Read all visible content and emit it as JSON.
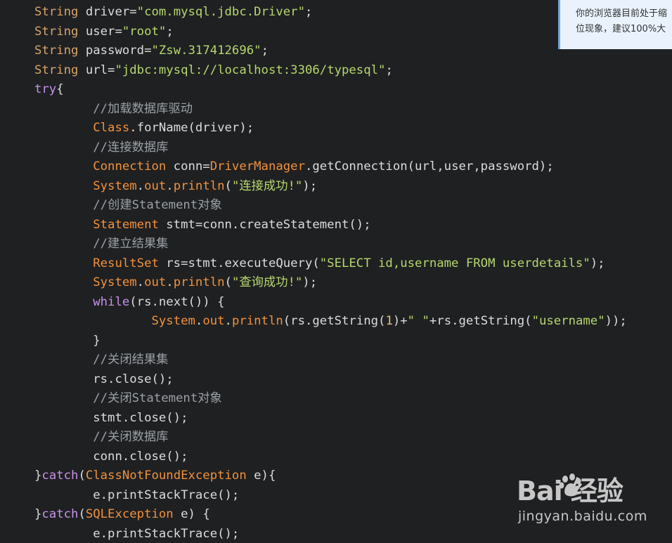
{
  "editor": {
    "lines": [
      [
        {
          "t": "String",
          "c": "kw-type"
        },
        {
          "t": " driver=",
          "c": "fn"
        },
        {
          "t": "\"com.mysql.jdbc.Driver\"",
          "c": "str"
        },
        {
          "t": ";",
          "c": "fn"
        }
      ],
      [
        {
          "t": "String",
          "c": "kw-type"
        },
        {
          "t": " user=",
          "c": "fn"
        },
        {
          "t": "\"root\"",
          "c": "str"
        },
        {
          "t": ";",
          "c": "fn"
        }
      ],
      [
        {
          "t": "String",
          "c": "kw-type"
        },
        {
          "t": " password=",
          "c": "fn"
        },
        {
          "t": "\"Zsw.317412696\"",
          "c": "str"
        },
        {
          "t": ";",
          "c": "fn"
        }
      ],
      [
        {
          "t": "String",
          "c": "kw-type"
        },
        {
          "t": " url=",
          "c": "fn"
        },
        {
          "t": "\"jdbc:mysql://localhost:3306/typesql\"",
          "c": "str"
        },
        {
          "t": ";",
          "c": "fn"
        }
      ],
      [
        {
          "t": "try",
          "c": "kw"
        },
        {
          "t": "{",
          "c": "fn"
        }
      ],
      [
        {
          "t": "        //加载数据库驱动",
          "c": "cmt"
        }
      ],
      [
        {
          "t": "        ",
          "c": "fn"
        },
        {
          "t": "Class",
          "c": "cls"
        },
        {
          "t": ".forName(driver);",
          "c": "fn"
        }
      ],
      [
        {
          "t": "        //连接数据库",
          "c": "cmt"
        }
      ],
      [
        {
          "t": "        ",
          "c": "fn"
        },
        {
          "t": "Connection",
          "c": "cls"
        },
        {
          "t": " conn=",
          "c": "fn"
        },
        {
          "t": "DriverManager",
          "c": "cls"
        },
        {
          "t": ".getConnection(url,user,password);",
          "c": "fn"
        }
      ],
      [
        {
          "t": "        ",
          "c": "fn"
        },
        {
          "t": "System",
          "c": "cls"
        },
        {
          "t": ".",
          "c": "fn"
        },
        {
          "t": "out",
          "c": "cls"
        },
        {
          "t": ".",
          "c": "fn"
        },
        {
          "t": "println",
          "c": "cls"
        },
        {
          "t": "(",
          "c": "fn"
        },
        {
          "t": "\"连接成功!\"",
          "c": "str"
        },
        {
          "t": ");",
          "c": "fn"
        }
      ],
      [
        {
          "t": "        //创建Statement对象",
          "c": "cmt"
        }
      ],
      [
        {
          "t": "        ",
          "c": "fn"
        },
        {
          "t": "Statement",
          "c": "cls"
        },
        {
          "t": " stmt=conn.createStatement();",
          "c": "fn"
        }
      ],
      [
        {
          "t": "        //建立结果集",
          "c": "cmt"
        }
      ],
      [
        {
          "t": "        ",
          "c": "fn"
        },
        {
          "t": "ResultSet",
          "c": "cls"
        },
        {
          "t": " rs=stmt.executeQuery(",
          "c": "fn"
        },
        {
          "t": "\"SELECT id,username FROM userdetails\"",
          "c": "str"
        },
        {
          "t": ");",
          "c": "fn"
        }
      ],
      [
        {
          "t": "        ",
          "c": "fn"
        },
        {
          "t": "System",
          "c": "cls"
        },
        {
          "t": ".",
          "c": "fn"
        },
        {
          "t": "out",
          "c": "cls"
        },
        {
          "t": ".",
          "c": "fn"
        },
        {
          "t": "println",
          "c": "cls"
        },
        {
          "t": "(",
          "c": "fn"
        },
        {
          "t": "\"查询成功!\"",
          "c": "str"
        },
        {
          "t": ");",
          "c": "fn"
        }
      ],
      [
        {
          "t": "        ",
          "c": "fn"
        },
        {
          "t": "while",
          "c": "kw"
        },
        {
          "t": "(rs.next()) {",
          "c": "fn"
        }
      ],
      [
        {
          "t": "                ",
          "c": "fn"
        },
        {
          "t": "System",
          "c": "cls"
        },
        {
          "t": ".",
          "c": "fn"
        },
        {
          "t": "out",
          "c": "cls"
        },
        {
          "t": ".",
          "c": "fn"
        },
        {
          "t": "println",
          "c": "cls"
        },
        {
          "t": "(rs.getString(",
          "c": "fn"
        },
        {
          "t": "1",
          "c": "num"
        },
        {
          "t": ")+",
          "c": "fn"
        },
        {
          "t": "\" \"",
          "c": "str"
        },
        {
          "t": "+rs.getString(",
          "c": "fn"
        },
        {
          "t": "\"username\"",
          "c": "str"
        },
        {
          "t": "));",
          "c": "fn"
        }
      ],
      [
        {
          "t": "        }",
          "c": "fn"
        }
      ],
      [
        {
          "t": "        //关闭结果集",
          "c": "cmt"
        }
      ],
      [
        {
          "t": "        rs.close();",
          "c": "fn"
        }
      ],
      [
        {
          "t": "        //关闭Statement对象",
          "c": "cmt"
        }
      ],
      [
        {
          "t": "        stmt.close();",
          "c": "fn"
        }
      ],
      [
        {
          "t": "        //关闭数据库",
          "c": "cmt"
        }
      ],
      [
        {
          "t": "        conn.close();",
          "c": "fn"
        }
      ],
      [
        {
          "t": "}",
          "c": "fn"
        },
        {
          "t": "catch",
          "c": "kw"
        },
        {
          "t": "(",
          "c": "fn"
        },
        {
          "t": "ClassNotFoundException",
          "c": "cls"
        },
        {
          "t": " e){",
          "c": "fn"
        }
      ],
      [
        {
          "t": "        e.printStackTrace();",
          "c": "fn"
        }
      ],
      [
        {
          "t": "}",
          "c": "fn"
        },
        {
          "t": "catch",
          "c": "kw"
        },
        {
          "t": "(",
          "c": "fn"
        },
        {
          "t": "SQLException",
          "c": "cls"
        },
        {
          "t": " e) {",
          "c": "fn"
        }
      ],
      [
        {
          "t": "        e.printStackTrace();",
          "c": "fn"
        }
      ]
    ]
  },
  "notice": {
    "line1": "你的浏览器目前处于缩",
    "line2": "位现象，建议100%大"
  },
  "watermark": {
    "brand": "Bai   经验",
    "url": "jingyan.baidu.com"
  },
  "colors": {
    "background": "#1f2022",
    "type_keyword": "#d7a46a",
    "keyword": "#c792ea",
    "string": "#b5d86e",
    "comment": "#9aa0a6",
    "class": "#f1913d"
  }
}
